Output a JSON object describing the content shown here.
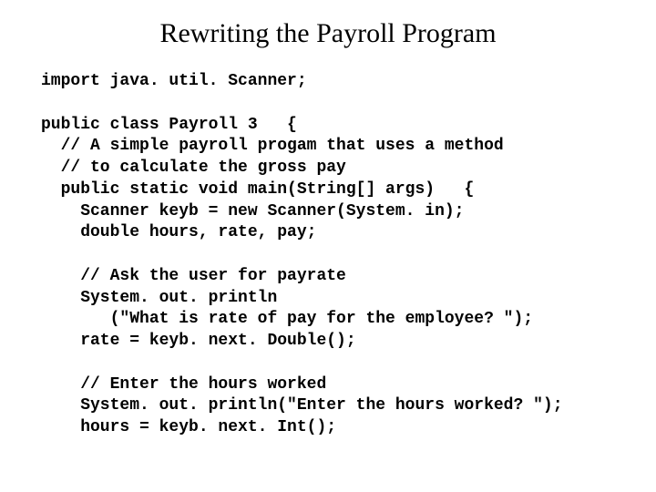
{
  "title": "Rewriting the Payroll Program",
  "code": {
    "l01": "import java. util. Scanner;",
    "l02": "",
    "l03": "public class Payroll 3   {",
    "l04": "  // A simple payroll progam that uses a method",
    "l05": "  // to calculate the gross pay",
    "l06": "  public static void main(String[] args)   {",
    "l07": "    Scanner keyb = new Scanner(System. in);",
    "l08": "    double hours, rate, pay;",
    "l09": "",
    "l10": "    // Ask the user for payrate",
    "l11": "    System. out. println",
    "l12": "       (\"What is rate of pay for the employee? \");",
    "l13": "    rate = keyb. next. Double();",
    "l14": "",
    "l15": "    // Enter the hours worked",
    "l16": "    System. out. println(\"Enter the hours worked? \");",
    "l17": "    hours = keyb. next. Int();"
  }
}
